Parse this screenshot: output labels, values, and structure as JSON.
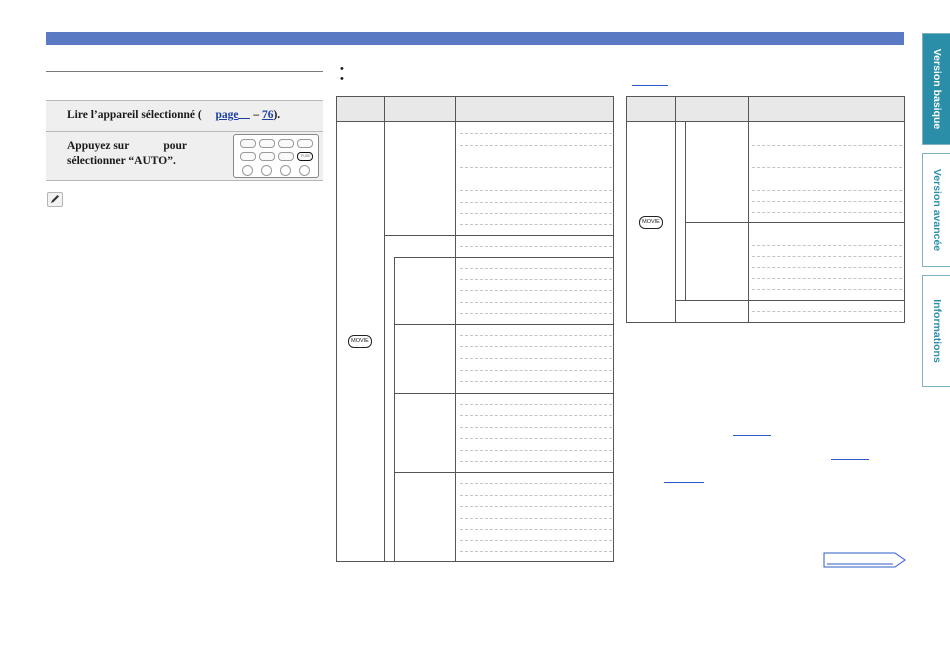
{
  "steps": {
    "step1_text": "Lire l’appareil sélectionné (",
    "step1_link_page": "page",
    "step1_dash": "–",
    "step1_link_num": "76",
    "step1_end": ").",
    "step2_line1_a": "Appuyez sur",
    "step2_line1_b": "pour",
    "step2_line2": "sélectionner “AUTO”."
  },
  "remote": {
    "highlight_label": "PURE",
    "num_buttons": [
      "1",
      "2",
      "3",
      "4"
    ]
  },
  "tables": {
    "movie_button_label": "MOVIE"
  },
  "sidebar": {
    "tab1": "Version basique",
    "tab2": "Version avancée",
    "tab3": "Informations"
  },
  "colors": {
    "header_bar": "#5a7ac4",
    "tab_active": "#2a8ea8",
    "link": "#1a3fa0"
  }
}
